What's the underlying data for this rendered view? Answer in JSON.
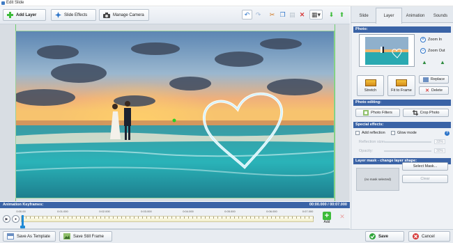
{
  "window": {
    "title": "Edit Slide"
  },
  "toolbar": {
    "add_layer": "Add Layer",
    "slide_effects": "Slide Effects",
    "manage_camera": "Manage Camera"
  },
  "keyframes": {
    "label": "Animation Keyframes:",
    "time": "00:00.000 / 00:07.000",
    "ruler": [
      "0:00.00",
      "0:01.000",
      "0:02.000",
      "0:03.000",
      "0:04.000",
      "0:05.000",
      "0:06.000",
      "0:07.000"
    ],
    "add_label": "Add"
  },
  "bottom": {
    "save_template": "Save As Template",
    "save_still": "Save Still Frame",
    "save": "Save",
    "cancel": "Cancel"
  },
  "panel": {
    "tabs": [
      "Slide",
      "Layer",
      "Animation",
      "Sounds"
    ],
    "active_tab": "Layer",
    "photo_section": "Photo:",
    "zoom_in": "Zoom In",
    "zoom_out": "Zoom Out",
    "stretch": "Stretch",
    "fit_to_frame": "Fit to Frame",
    "replace": "Replace",
    "delete": "Delete",
    "photo_editing": "Photo editing:",
    "photo_filters": "Photo Filters",
    "crop_photo": "Crop Photo",
    "special_effects": "Special effects:",
    "add_reflection": "Add reflection",
    "glow_mode": "Glow mode",
    "reflection_size_label": "Reflection size:",
    "reflection_size_value": "33%",
    "opacity_label": "Opacity:",
    "opacity_value": "30%",
    "layer_mask": "Layer mask - change layer shape:",
    "no_mask": "(no mask selected)",
    "select_mask": "Select Mask...",
    "clear": "Clear"
  },
  "colors": {
    "accent": "#3a63a6",
    "add_green": "#3dbb3a",
    "delete_red": "#d63b3b"
  }
}
